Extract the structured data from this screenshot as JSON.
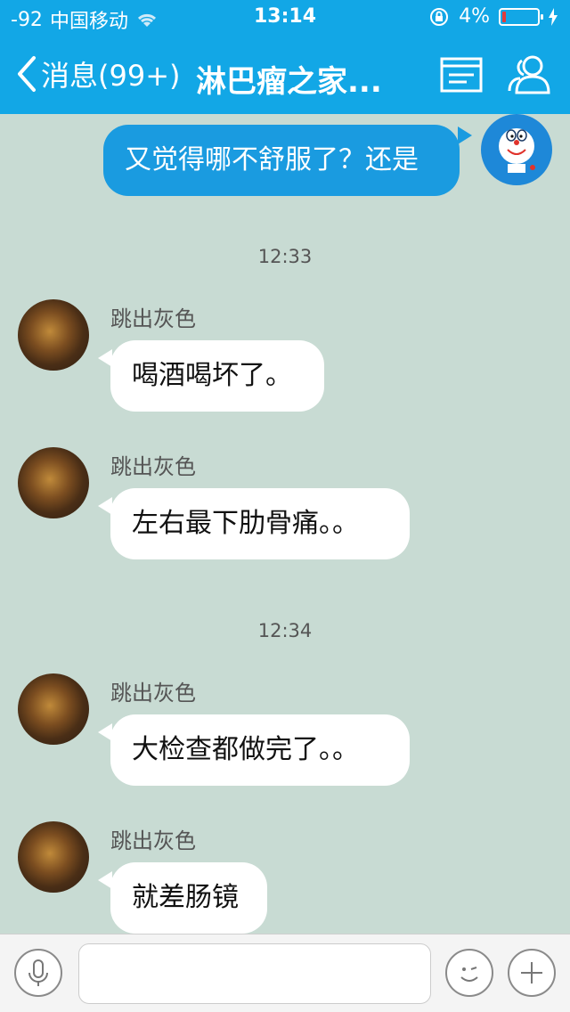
{
  "status_bar": {
    "signal": "-92",
    "carrier": "中国移动",
    "time": "13:14",
    "battery": "4%"
  },
  "nav": {
    "back_label": "消息(99+)",
    "title": "淋巴瘤之家..."
  },
  "messages": [
    {
      "type": "out",
      "text": "又觉得哪不舒服了？还是"
    },
    {
      "type": "time",
      "text": "12:33"
    },
    {
      "type": "in",
      "sender": "跳出灰色",
      "text": "喝酒喝坏了。"
    },
    {
      "type": "in",
      "sender": "跳出灰色",
      "text": "左右最下肋骨痛。。"
    },
    {
      "type": "time",
      "text": "12:34"
    },
    {
      "type": "in",
      "sender": "跳出灰色",
      "text": "大检查都做完了。。"
    },
    {
      "type": "in",
      "sender": "跳出灰色",
      "text": "就差肠镜"
    }
  ],
  "input": {
    "placeholder": ""
  },
  "colors": {
    "header": "#12a7e6",
    "chat_bg": "#c8dbd3",
    "outgoing_bubble": "#1a9be0"
  }
}
